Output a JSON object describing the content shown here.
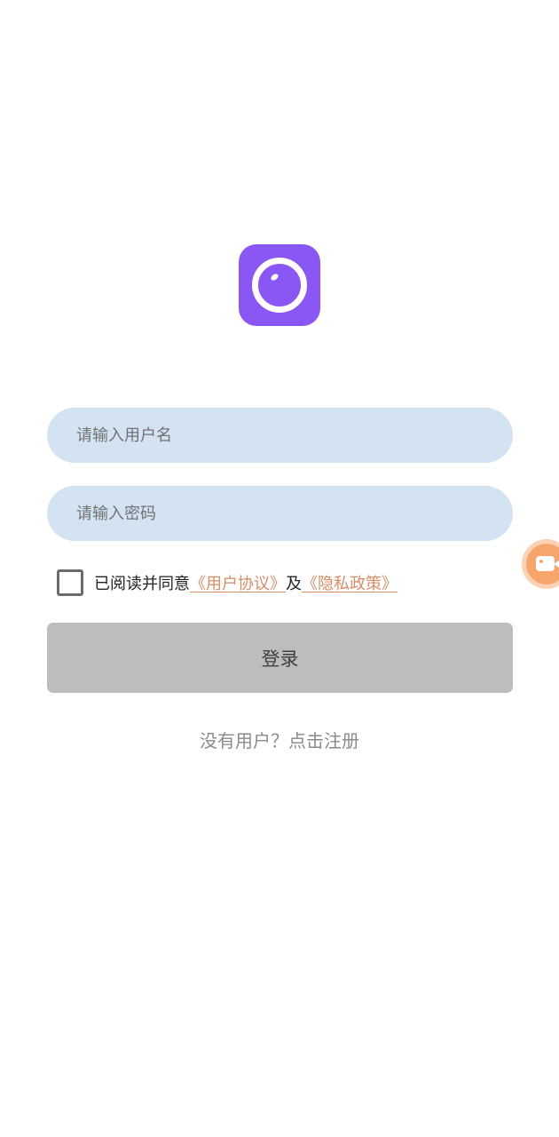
{
  "app": {
    "logo_icon": "camera-lens-icon",
    "logo_color": "#8a57f5"
  },
  "form": {
    "username_placeholder": "请输入用户名",
    "username_value": "",
    "password_placeholder": "请输入密码",
    "password_value": ""
  },
  "agreement": {
    "checked": false,
    "prefix": "已阅读并同意",
    "user_agreement": "《用户协议》",
    "conjunction": "及",
    "privacy_policy": "《隐私政策》",
    "link_color": "#d88e64"
  },
  "actions": {
    "login_label": "登录",
    "register_prompt": "没有用户？点击注册"
  },
  "floating": {
    "icon": "video-camera-icon",
    "color": "#f6a66a"
  }
}
